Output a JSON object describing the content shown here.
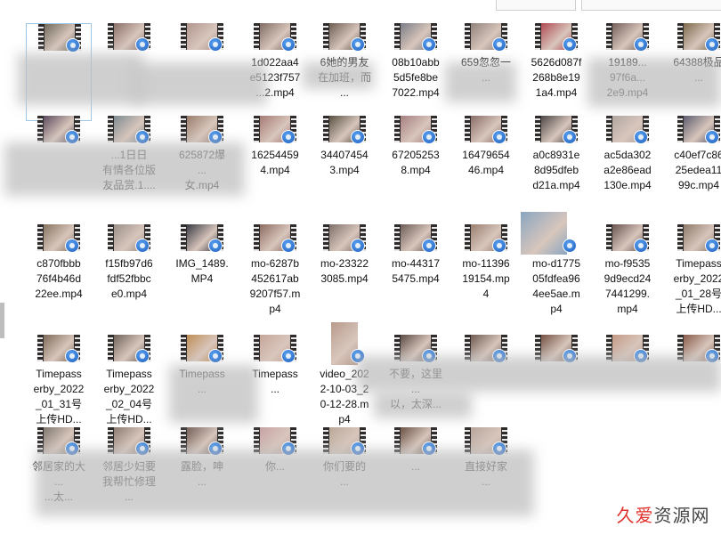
{
  "window": {
    "title": ""
  },
  "watermark": {
    "text1": "久爱",
    "text2": "资源网"
  },
  "files": [
    {
      "label": "",
      "color": "#6f6a5c",
      "row": 0,
      "col": 0,
      "selected": true
    },
    {
      "label": "",
      "color": "#8a6f68",
      "row": 0,
      "col": 1
    },
    {
      "label": "",
      "color": "#b1958d",
      "row": 0,
      "col": 2
    },
    {
      "label": "1d022aa4\ne5123f757\n...2.mp4",
      "color": "#7f6b62",
      "row": 0,
      "col": 3
    },
    {
      "label": "6她的男友\n在加班，而\n...",
      "color": "#6b5c52",
      "row": 0,
      "col": 4
    },
    {
      "label": "08b10abb\n5d5fe8be\n7022.mp4",
      "color": "#7a7c86",
      "row": 0,
      "col": 5
    },
    {
      "label": "659忽忽一\n...",
      "color": "#90827c",
      "row": 0,
      "col": 6
    },
    {
      "label": "5626d087f\n268b8e19\n1a4.mp4",
      "color": "#b04a53",
      "row": 0,
      "col": 7
    },
    {
      "label": "19189...\n97f6a...\n2e9.mp4",
      "color": "#745f5a",
      "row": 0,
      "col": 8
    },
    {
      "label": "64388极品\n...",
      "color": "#7d6a4d",
      "row": 0,
      "col": 9
    },
    {
      "label": "",
      "color": "#5c4a5e",
      "row": 1,
      "col": 0
    },
    {
      "label": "...1日日\n有情各位版\n友品赏.1....",
      "color": "#7c8a90",
      "row": 1,
      "col": 1
    },
    {
      "label": "625872爆\n...\n女.mp4",
      "color": "#9a7d6c",
      "row": 1,
      "col": 2
    },
    {
      "label": "16254459\n4.mp4",
      "color": "#a57a74",
      "row": 1,
      "col": 3
    },
    {
      "label": "34407454\n3.mp4",
      "color": "#585142",
      "row": 1,
      "col": 4
    },
    {
      "label": "67205253\n8.mp4",
      "color": "#a67f80",
      "row": 1,
      "col": 5
    },
    {
      "label": "16479654\n46.mp4",
      "color": "#8a6d68",
      "row": 1,
      "col": 6
    },
    {
      "label": "a0c8931e\n8d95dfeb\nd21a.mp4",
      "color": "#4d4646",
      "row": 1,
      "col": 7
    },
    {
      "label": "ac5da302\na2e86ead\n130e.mp4",
      "color": "#b0a6a1",
      "row": 1,
      "col": 8
    },
    {
      "label": "c40ef7c86\n25edea11\n99c.mp4",
      "color": "#5c5b6f",
      "row": 1,
      "col": 9
    },
    {
      "label": "c870fbbb\n76f4b46d\n22ee.mp4",
      "color": "#877461",
      "row": 2,
      "col": 0
    },
    {
      "label": "f15fb97d6\nfdf52fbbc\ne0.mp4",
      "color": "#9a8f88",
      "row": 2,
      "col": 1
    },
    {
      "label": "IMG_1489.\nMP4",
      "color": "#3a3a44",
      "row": 2,
      "col": 2
    },
    {
      "label": "mo-6287b\n452617ab\n9207f57.m\np4",
      "color": "#8d6b61",
      "row": 2,
      "col": 3
    },
    {
      "label": "mo-23322\n3085.mp4",
      "color": "#7f6f6a",
      "row": 2,
      "col": 4
    },
    {
      "label": "mo-44317\n5475.mp4",
      "color": "#6c5b55",
      "row": 2,
      "col": 5
    },
    {
      "label": "mo-11396\n19154.mp\n4",
      "color": "#9b7f70",
      "row": 2,
      "col": 6
    },
    {
      "label": "mo-d1775\n05fdfea96\n4ee5ae.m\np4",
      "color": "#8aa6c0",
      "row": 2,
      "col": 7,
      "tall": "tall2"
    },
    {
      "label": "mo-f9535\n9d9ecd24\n7441299.\nmp4",
      "color": "#6a5552",
      "row": 2,
      "col": 8
    },
    {
      "label": "Timepass\nerby_2022\n_01_28号\n上传HD...",
      "color": "#8c7a6b",
      "row": 2,
      "col": 9
    },
    {
      "label": "Timepass\nerby_2022\n_01_31号\n上传HD...",
      "color": "#7d6a57",
      "row": 3,
      "col": 0
    },
    {
      "label": "Timepass\nerby_2022\n_02_04号\n上传HD...",
      "color": "#6f6259",
      "row": 3,
      "col": 1
    },
    {
      "label": "Timepass\n...",
      "color": "#bf8e55",
      "row": 3,
      "col": 2
    },
    {
      "label": "Timepass\n...",
      "color": "#c7a69a",
      "row": 3,
      "col": 3
    },
    {
      "label": "video_202\n2-10-03_2\n0-12-28.m\np4",
      "color": "#b89a8c",
      "row": 3,
      "col": 4,
      "tall": "tall"
    },
    {
      "label": "不要，这里\n...\n以，太深...",
      "color": "#5c4b44",
      "row": 3,
      "col": 5
    },
    {
      "label": "",
      "color": "#6e5a52",
      "row": 3,
      "col": 6
    },
    {
      "label": "",
      "color": "#735143",
      "row": 3,
      "col": 7
    },
    {
      "label": "",
      "color": "#c49a86",
      "row": 3,
      "col": 8
    },
    {
      "label": "",
      "color": "#8a5c4b",
      "row": 3,
      "col": 9
    },
    {
      "label": "邻居家的大\n...\n...太...",
      "color": "#7d776f",
      "row": 4,
      "col": 0
    },
    {
      "label": "邻居少妇要\n我帮忙修理\n...",
      "color": "#8b7a70",
      "row": 4,
      "col": 1
    },
    {
      "label": "露脸，呻\n...",
      "color": "#6f5a52",
      "row": 4,
      "col": 2
    },
    {
      "label": "你...",
      "color": "#c7a3a5",
      "row": 4,
      "col": 3
    },
    {
      "label": "你们要的\n...",
      "color": "#b9a899",
      "row": 4,
      "col": 4
    },
    {
      "label": "...",
      "color": "#6a5145",
      "row": 4,
      "col": 5
    },
    {
      "label": "直接好家\n...",
      "color": "#b7a59d",
      "row": 4,
      "col": 6
    }
  ]
}
